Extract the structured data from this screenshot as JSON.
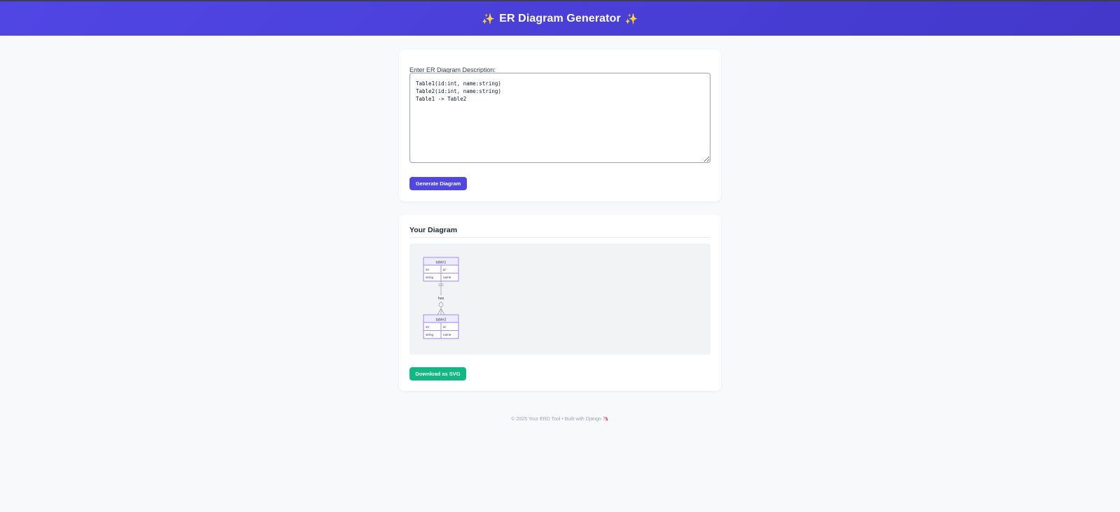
{
  "header": {
    "title": "ER Diagram Generator",
    "spark_left": "✨",
    "spark_right": "✨"
  },
  "input_card": {
    "label": "Enter ER Diagram Description:",
    "textarea_value": "Table1(id:int, name:string)\nTable2(id:int, name:string)\nTable1 -> Table2",
    "generate_label": "Generate Diagram"
  },
  "output_card": {
    "title": "Your Diagram",
    "download_label": "Download as SVG",
    "diagram": {
      "relationship_label": "has",
      "entities": [
        {
          "name": "table1",
          "rows": [
            {
              "type": "int",
              "attr": "id"
            },
            {
              "type": "string",
              "attr": "name"
            }
          ]
        },
        {
          "name": "table2",
          "rows": [
            {
              "type": "int",
              "attr": "id"
            },
            {
              "type": "string",
              "attr": "name"
            }
          ]
        }
      ]
    }
  },
  "footer": {
    "text": "© 2025 Your ERD Tool • Built with Django",
    "icon": "🦄"
  },
  "colors": {
    "header_gradient_start": "#5046e5",
    "header_gradient_end": "#4338ca",
    "generate_button": "#4f46e5",
    "download_button": "#10b981",
    "entity_fill": "#ececfc",
    "entity_stroke": "#a78bfa"
  }
}
